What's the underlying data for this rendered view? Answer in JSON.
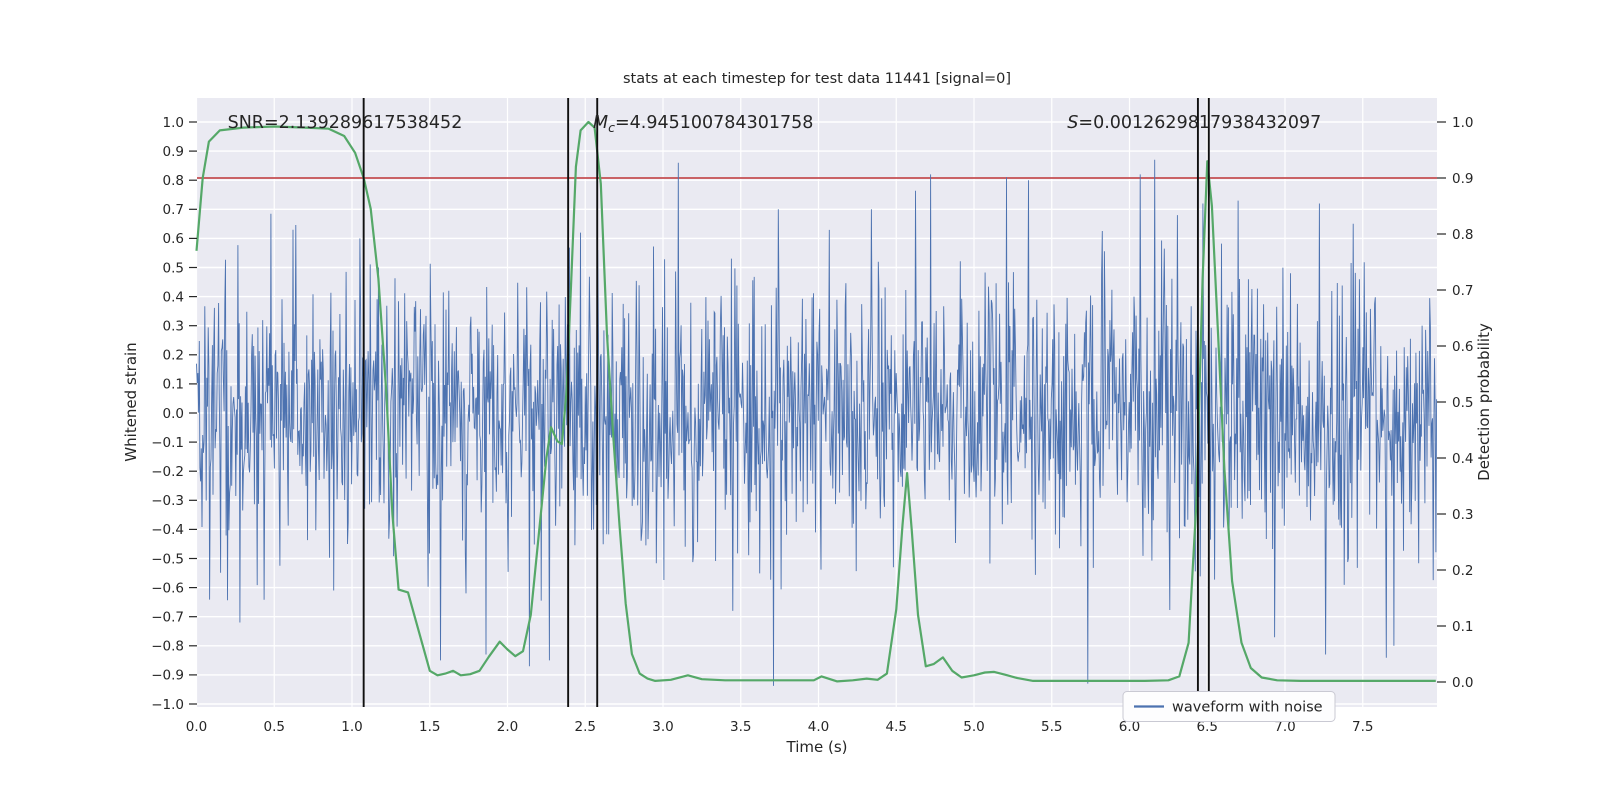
{
  "colors": {
    "figure_bg": "#ffffff",
    "axes_bg": "#eaeaf2",
    "grid": "#ffffff",
    "noise_blue": "#4c72b0",
    "prob_green": "#55a868",
    "threshold_red": "#c44e52",
    "event_black": "#0f0f0f",
    "text": "#262626",
    "legend_border": "#c9c9d3",
    "legend_bg": "#fdfdfe"
  },
  "chart_data": {
    "type": "line",
    "title": "stats at each timestep for test data 11441 [signal=0]",
    "xlabel": "Time (s)",
    "x_range": [
      0.0,
      7.975
    ],
    "x_tick_step": 0.5,
    "x_ticks": [
      0.0,
      0.5,
      1.0,
      1.5,
      2.0,
      2.5,
      3.0,
      3.5,
      4.0,
      4.5,
      5.0,
      5.5,
      6.0,
      6.5,
      7.0,
      7.5
    ],
    "left_axis": {
      "label": "Whitened strain",
      "range": [
        -1.0,
        1.0
      ],
      "tick_step": 0.1
    },
    "right_axis": {
      "label": "Detection probability",
      "range": [
        0.0,
        1.0
      ],
      "tick_step": 0.1
    },
    "stats": {
      "SNR": 2.139289617538452,
      "Mc": 4.945100784301758,
      "S": 0.0012629817938432097
    },
    "annotations": [
      {
        "text": "SNR=2.139289617538452",
        "x": 0.2,
        "parts": [
          {
            "t": "SNR=2.139289617538452"
          }
        ]
      },
      {
        "text": "Mc=4.945100784301758",
        "x": 2.55,
        "parts": [
          {
            "t": "M",
            "italic": true
          },
          {
            "t": "c",
            "italic": true,
            "sub": true
          },
          {
            "t": "=4.945100784301758"
          }
        ]
      },
      {
        "text": "S=0.0012629817938432097",
        "x": 5.6,
        "parts": [
          {
            "t": "S",
            "italic": true
          },
          {
            "t": "=0.0012629817938432097"
          }
        ]
      }
    ],
    "hlines": [
      {
        "axis": "right",
        "y": 0.9,
        "color": "#c44e52",
        "name": "detection-threshold"
      }
    ],
    "vlines": {
      "color": "#0f0f0f",
      "x": [
        1.075,
        2.39,
        2.577,
        6.44,
        6.51
      ]
    },
    "series": [
      {
        "name": "waveform with noise",
        "axis": "left",
        "color": "#4c72b0",
        "kind": "seeded-gaussian-noise",
        "seed": 11441,
        "n": 1800,
        "sigma": 0.23,
        "clip": 0.95,
        "outliers": [
          [
            0.28,
            -0.72
          ],
          [
            0.62,
            0.63
          ],
          [
            1.05,
            0.6
          ],
          [
            1.57,
            -0.85
          ],
          [
            1.86,
            -0.83
          ],
          [
            2.14,
            -0.87
          ],
          [
            2.27,
            -0.85
          ],
          [
            2.47,
            0.62
          ],
          [
            3.1,
            0.86
          ],
          [
            3.45,
            -0.68
          ],
          [
            3.74,
            0.7
          ],
          [
            4.34,
            0.7
          ],
          [
            4.72,
            0.82
          ],
          [
            5.21,
            0.81
          ],
          [
            5.35,
            0.8
          ],
          [
            5.73,
            -0.93
          ],
          [
            6.07,
            0.82
          ],
          [
            6.16,
            0.87
          ],
          [
            6.31,
            0.68
          ],
          [
            6.47,
            0.72
          ],
          [
            6.7,
            0.73
          ],
          [
            7.22,
            0.72
          ],
          [
            7.26,
            -0.83
          ],
          [
            7.44,
            0.65
          ],
          [
            7.7,
            -0.8
          ]
        ]
      },
      {
        "name": "detection probability",
        "axis": "right",
        "color": "#55a868",
        "kind": "points",
        "points": [
          [
            0,
            0.77
          ],
          [
            0.04,
            0.9
          ],
          [
            0.08,
            0.965
          ],
          [
            0.15,
            0.985
          ],
          [
            0.3,
            0.99
          ],
          [
            0.5,
            0.992
          ],
          [
            0.7,
            0.99
          ],
          [
            0.85,
            0.988
          ],
          [
            0.95,
            0.975
          ],
          [
            1.02,
            0.945
          ],
          [
            1.075,
            0.9
          ],
          [
            1.12,
            0.845
          ],
          [
            1.17,
            0.72
          ],
          [
            1.22,
            0.52
          ],
          [
            1.26,
            0.3
          ],
          [
            1.3,
            0.165
          ],
          [
            1.36,
            0.16
          ],
          [
            1.4,
            0.12
          ],
          [
            1.45,
            0.07
          ],
          [
            1.5,
            0.02
          ],
          [
            1.55,
            0.012
          ],
          [
            1.6,
            0.015
          ],
          [
            1.65,
            0.02
          ],
          [
            1.7,
            0.012
          ],
          [
            1.76,
            0.014
          ],
          [
            1.82,
            0.02
          ],
          [
            1.88,
            0.045
          ],
          [
            1.95,
            0.072
          ],
          [
            2.0,
            0.058
          ],
          [
            2.05,
            0.046
          ],
          [
            2.1,
            0.055
          ],
          [
            2.15,
            0.12
          ],
          [
            2.2,
            0.26
          ],
          [
            2.25,
            0.4
          ],
          [
            2.28,
            0.455
          ],
          [
            2.32,
            0.43
          ],
          [
            2.35,
            0.425
          ],
          [
            2.38,
            0.52
          ],
          [
            2.41,
            0.72
          ],
          [
            2.44,
            0.92
          ],
          [
            2.47,
            0.985
          ],
          [
            2.52,
            1.0
          ],
          [
            2.56,
            0.99
          ],
          [
            2.6,
            0.89
          ],
          [
            2.64,
            0.62
          ],
          [
            2.68,
            0.44
          ],
          [
            2.72,
            0.28
          ],
          [
            2.76,
            0.14
          ],
          [
            2.8,
            0.05
          ],
          [
            2.85,
            0.015
          ],
          [
            2.9,
            0.006
          ],
          [
            2.95,
            0.002
          ],
          [
            3.05,
            0.004
          ],
          [
            3.16,
            0.012
          ],
          [
            3.25,
            0.005
          ],
          [
            3.4,
            0.003
          ],
          [
            3.6,
            0.003
          ],
          [
            3.8,
            0.003
          ],
          [
            3.97,
            0.003
          ],
          [
            4.02,
            0.01
          ],
          [
            4.12,
            0.001
          ],
          [
            4.22,
            0.003
          ],
          [
            4.31,
            0.006
          ],
          [
            4.38,
            0.004
          ],
          [
            4.44,
            0.015
          ],
          [
            4.5,
            0.13
          ],
          [
            4.54,
            0.28
          ],
          [
            4.57,
            0.373
          ],
          [
            4.6,
            0.27
          ],
          [
            4.64,
            0.12
          ],
          [
            4.69,
            0.028
          ],
          [
            4.74,
            0.032
          ],
          [
            4.8,
            0.044
          ],
          [
            4.86,
            0.02
          ],
          [
            4.92,
            0.008
          ],
          [
            5.0,
            0.012
          ],
          [
            5.07,
            0.017
          ],
          [
            5.13,
            0.018
          ],
          [
            5.2,
            0.013
          ],
          [
            5.28,
            0.007
          ],
          [
            5.38,
            0.002
          ],
          [
            5.5,
            0.002
          ],
          [
            5.7,
            0.002
          ],
          [
            5.9,
            0.002
          ],
          [
            6.1,
            0.002
          ],
          [
            6.25,
            0.003
          ],
          [
            6.32,
            0.01
          ],
          [
            6.38,
            0.07
          ],
          [
            6.43,
            0.32
          ],
          [
            6.47,
            0.72
          ],
          [
            6.5,
            0.93
          ],
          [
            6.53,
            0.85
          ],
          [
            6.57,
            0.62
          ],
          [
            6.61,
            0.38
          ],
          [
            6.66,
            0.18
          ],
          [
            6.72,
            0.07
          ],
          [
            6.78,
            0.025
          ],
          [
            6.85,
            0.008
          ],
          [
            6.95,
            0.003
          ],
          [
            7.1,
            0.002
          ],
          [
            7.3,
            0.002
          ],
          [
            7.6,
            0.002
          ],
          [
            7.97,
            0.002
          ]
        ]
      }
    ],
    "legend": {
      "entries": [
        "waveform with noise"
      ],
      "position": "lower right"
    },
    "grid": true
  }
}
